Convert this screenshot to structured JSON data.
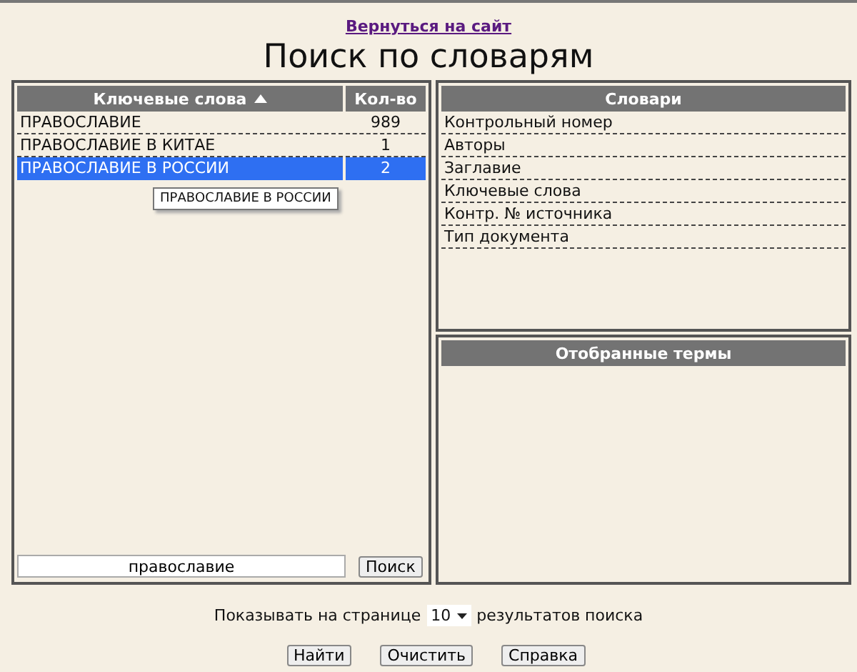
{
  "back_link": "Вернуться на сайт",
  "title": "Поиск по словарям",
  "keywords_table": {
    "columns": [
      "Ключевые слова",
      "Кол-во"
    ],
    "sorted_ascending": true,
    "rows": [
      {
        "keyword": "ПРАВОСЛАВИЕ",
        "count": "989",
        "selected": false
      },
      {
        "keyword": "ПРАВОСЛАВИЕ В КИТАЕ",
        "count": "1",
        "selected": false
      },
      {
        "keyword": "ПРАВОСЛАВИЕ В РОССИИ",
        "count": "2",
        "selected": true
      }
    ],
    "tooltip": "ПРАВОСЛАВИЕ В РОССИИ",
    "search_value": "православие",
    "search_button": "Поиск"
  },
  "dictionaries": {
    "title": "Словари",
    "items": [
      "Контрольный номер",
      "Авторы",
      "Заглавие",
      "Ключевые слова",
      "Контр. № источника",
      "Тип документа"
    ]
  },
  "selected_terms": {
    "title": "Отобранные термы"
  },
  "per_page": {
    "before": "Показывать на странице",
    "value": "10",
    "after": "результатов поиска"
  },
  "buttons": [
    "Найти",
    "Очистить",
    "Справка"
  ]
}
